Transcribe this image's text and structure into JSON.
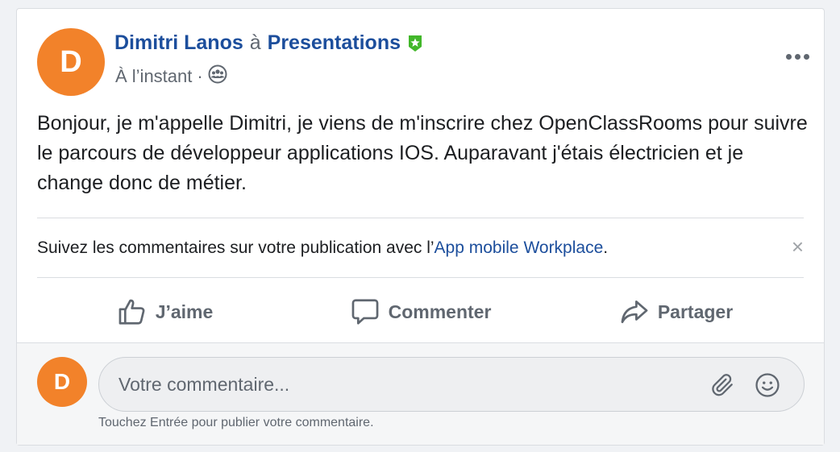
{
  "post": {
    "author": "Dimitri Lanos",
    "separator": "à",
    "group": "Presentations",
    "avatar_initial": "D",
    "timestamp": "À l’instant",
    "meta_separator": "·",
    "audience_icon": "group-audience-icon",
    "body": "Bonjour, je m'appelle Dimitri, je viens de m'inscrire chez OpenClassRooms pour suivre le parcours de développeur applications IOS. Auparavant j'étais électricien et je change donc de métier."
  },
  "notice": {
    "prefix": "Suivez les commentaires sur votre publication avec l’",
    "link": "App mobile Workplace",
    "suffix": ".",
    "close": "×"
  },
  "actions": {
    "like": "J’aime",
    "comment": "Commenter",
    "share": "Partager"
  },
  "comment_box": {
    "avatar_initial": "D",
    "placeholder": "Votre commentaire...",
    "value": "",
    "hint": "Touchez Entrée pour publier votre commentaire."
  },
  "colors": {
    "avatar": "#f2822a",
    "link": "#1c4e9c",
    "badge": "#42b72a",
    "muted": "#606770"
  }
}
